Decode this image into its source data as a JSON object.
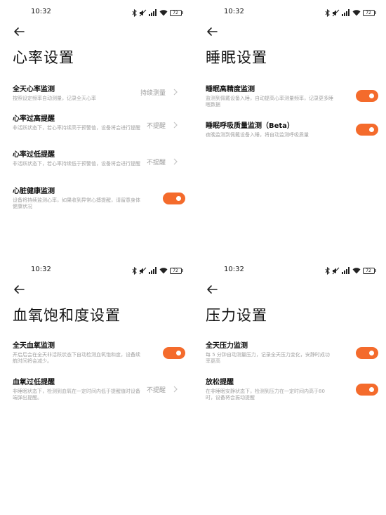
{
  "status": {
    "time": "10:32",
    "battery": "72"
  },
  "colors": {
    "accent": "#f46b2c",
    "muted": "#a3a3a3"
  },
  "screens": [
    {
      "title": "心率设置",
      "items": [
        {
          "title": "全天心率监测",
          "desc": "按照设定频率自动测量，记录全天心率",
          "value": "持续测量"
        },
        {
          "title": "心率过高提醒",
          "desc": "非活跃状态下，若心率持续高于预警值，设备将会进行提醒",
          "value": "不提醒"
        },
        {
          "title": "心率过低提醒",
          "desc": "非活跃状态下，若心率持续低于预警值，设备将会进行提醒",
          "value": "不提醒"
        },
        {
          "title": "心脏健康监测",
          "desc": "设备将持续监测心率，如果收到异常心搏提醒，请留意身体健康状况",
          "toggle": true
        }
      ]
    },
    {
      "title": "睡眠设置",
      "items": [
        {
          "title": "睡眠高精度监测",
          "desc": "监测到佩戴设备入睡，自动提高心率测量频率，记录更多睡眠数据",
          "toggle": true
        },
        {
          "title": "睡眠呼吸质量监测（Beta）",
          "desc": "夜晚监测到佩戴设备入睡，将自动监测呼吸质量",
          "toggle": true
        }
      ]
    },
    {
      "title": "血氧饱和度设置",
      "items": [
        {
          "title": "全天血氧监测",
          "desc": "开启后会在全天非活跃状态下自动检测血氧饱和度，设备续航时间将会减少。",
          "toggle": true
        },
        {
          "title": "血氧过低提醒",
          "desc": "非睡眠状态下，检测到血氧在一定时间内低于提醒值时设备端弹出提醒。",
          "value": "不提醒"
        }
      ]
    },
    {
      "title": "压力设置",
      "items": [
        {
          "title": "全天压力监测",
          "desc": "每 5 分钟自动测量压力，记录全天压力变化，安静时成功率更高",
          "toggle": true
        },
        {
          "title": "放松提醒",
          "desc": "在非睡眠安静状态下，检测到压力在一定时间内高于80时，设备将会振动提醒",
          "toggle": true
        }
      ]
    }
  ]
}
